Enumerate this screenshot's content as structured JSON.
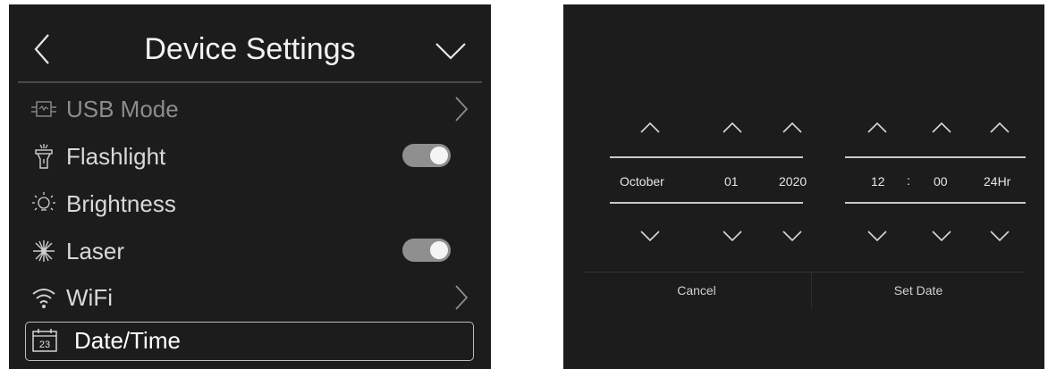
{
  "settings": {
    "title": "Device Settings",
    "items": [
      {
        "label": "USB Mode",
        "icon": "usb-mode-icon",
        "control": "chevron",
        "active": false
      },
      {
        "label": "Flashlight",
        "icon": "flashlight-icon",
        "control": "toggle",
        "state": "on",
        "active": true
      },
      {
        "label": "Brightness",
        "icon": "brightness-icon",
        "control": "none",
        "active": true
      },
      {
        "label": "Laser",
        "icon": "laser-icon",
        "control": "toggle",
        "state": "on",
        "active": true
      },
      {
        "label": "WiFi",
        "icon": "wifi-icon",
        "control": "chevron",
        "active": true
      },
      {
        "label": "Date/Time",
        "icon": "calendar-icon",
        "icon_text": "23",
        "control": "none",
        "selected": true
      }
    ]
  },
  "date_picker": {
    "month": "October",
    "day": "01",
    "year": "2020",
    "hour": "12",
    "separator": ":",
    "minute": "00",
    "format": "24Hr",
    "cancel_label": "Cancel",
    "set_label": "Set Date"
  },
  "colors": {
    "panel_bg": "#1c1c1c",
    "text_active": "#d9d9d9",
    "text_dim": "#8c8c8c",
    "toggle_track": "#8f8f8f",
    "toggle_knob": "#f4f4f4"
  }
}
